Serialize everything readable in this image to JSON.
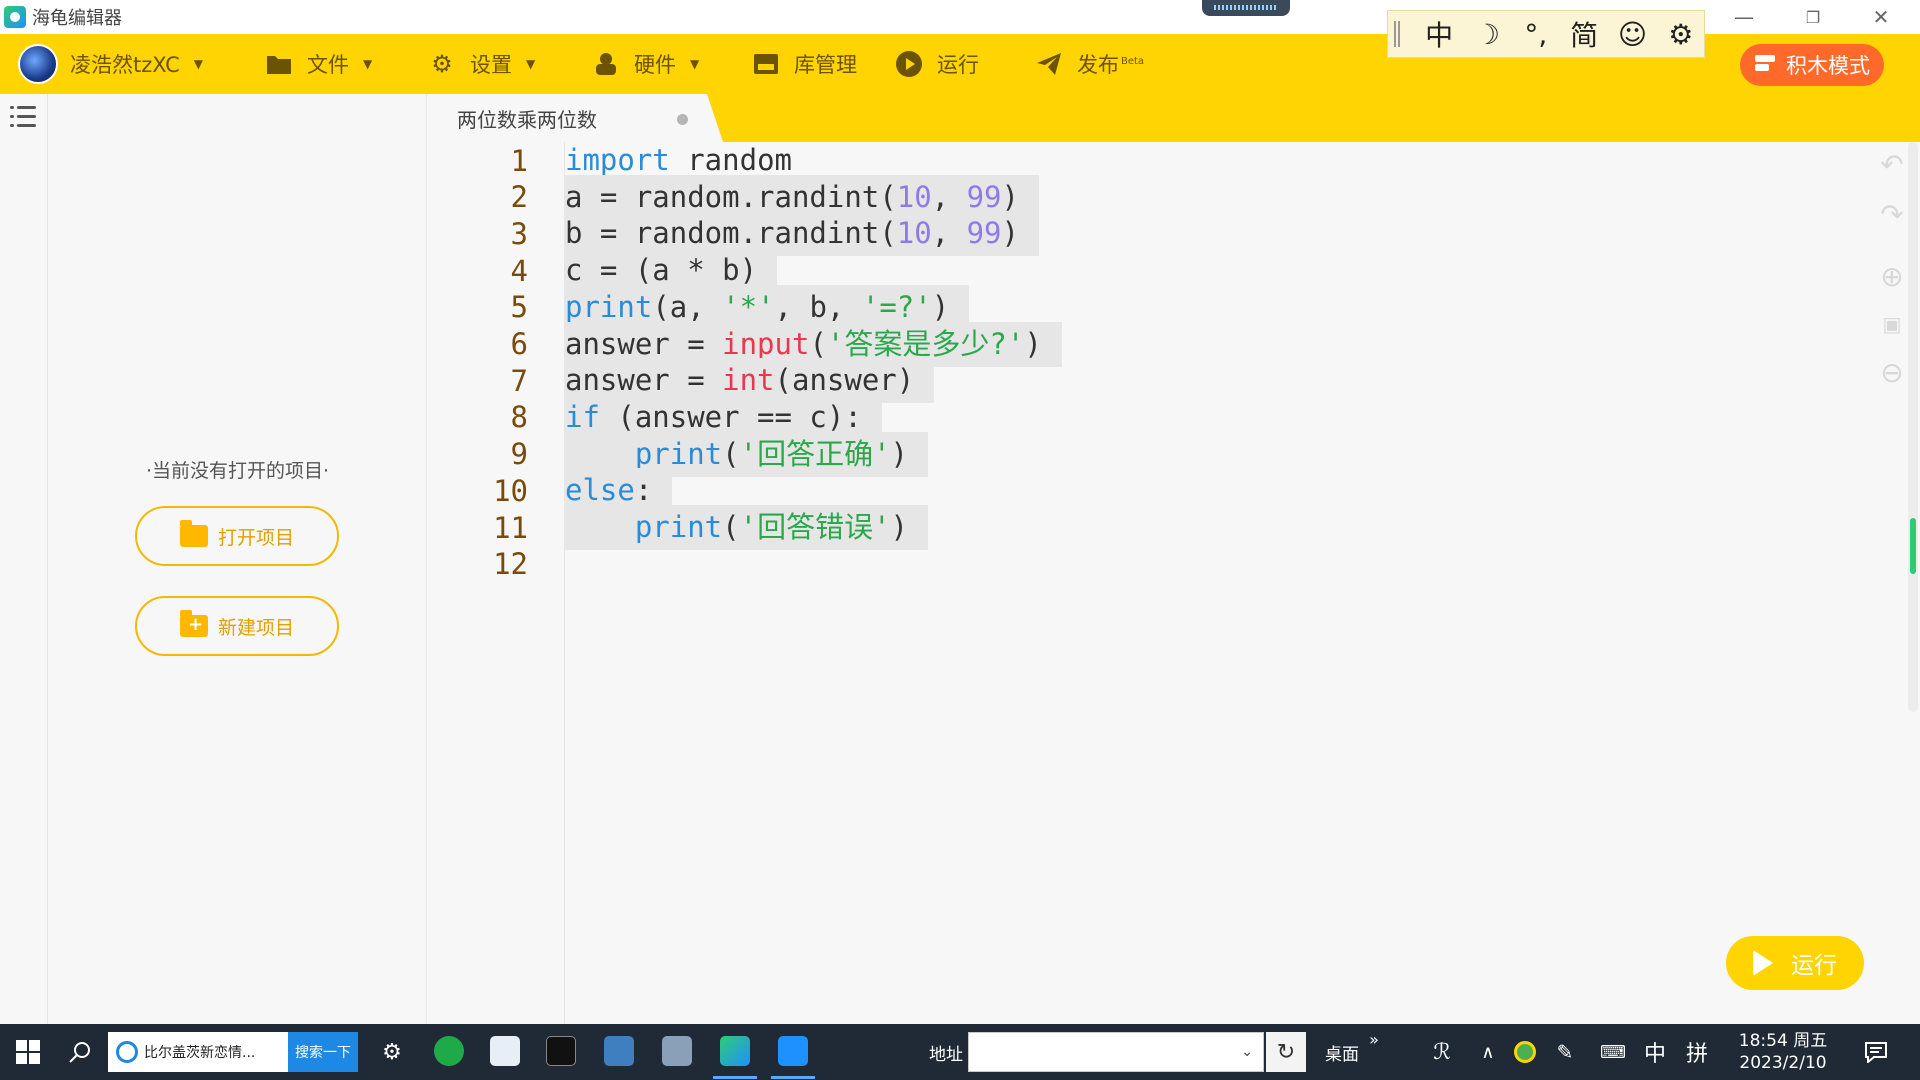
{
  "window": {
    "title": "海龟编辑器",
    "minimize": "—",
    "restore": "❐",
    "close": "✕"
  },
  "ime": {
    "items": [
      {
        "icon": "chinese-mode-icon",
        "glyph": "中"
      },
      {
        "icon": "moon-icon",
        "glyph": "☽"
      },
      {
        "icon": "punctuation-icon",
        "glyph": "°,"
      },
      {
        "icon": "simplified-icon",
        "glyph": "简"
      },
      {
        "icon": "emoji-icon",
        "glyph": "☺"
      },
      {
        "icon": "gear-icon",
        "glyph": "⚙"
      }
    ]
  },
  "toolbar": {
    "user_name": "凌浩然tzXC",
    "file_label": "文件",
    "settings_label": "设置",
    "hardware_label": "硬件",
    "library_label": "库管理",
    "run_label": "运行",
    "publish_label": "发布",
    "publish_badge": "Beta",
    "block_mode_label": "积木模式"
  },
  "tab": {
    "label": "两位数乘两位数"
  },
  "project_panel": {
    "empty_text": "·当前没有打开的项目·",
    "open_label": "打开项目",
    "new_label": "新建项目"
  },
  "editor": {
    "lines": [
      {
        "no": "1",
        "tokens": [
          {
            "t": "import",
            "c": "kw"
          },
          {
            "t": " random",
            "c": ""
          }
        ]
      },
      {
        "no": "2",
        "tokens": [
          {
            "t": "a = random.randint(",
            "c": ""
          },
          {
            "t": "10",
            "c": "num"
          },
          {
            "t": ", ",
            "c": ""
          },
          {
            "t": "99",
            "c": "num"
          },
          {
            "t": ")",
            "c": ""
          }
        ]
      },
      {
        "no": "3",
        "tokens": [
          {
            "t": "b = random.randint(",
            "c": ""
          },
          {
            "t": "10",
            "c": "num"
          },
          {
            "t": ", ",
            "c": ""
          },
          {
            "t": "99",
            "c": "num"
          },
          {
            "t": ")",
            "c": ""
          }
        ]
      },
      {
        "no": "4",
        "tokens": [
          {
            "t": "c = (a * b)",
            "c": ""
          }
        ]
      },
      {
        "no": "5",
        "tokens": [
          {
            "t": "print",
            "c": "fn"
          },
          {
            "t": "(a, ",
            "c": ""
          },
          {
            "t": "'*'",
            "c": "str"
          },
          {
            "t": ", b, ",
            "c": ""
          },
          {
            "t": "'=?'",
            "c": "str"
          },
          {
            "t": ")",
            "c": ""
          }
        ]
      },
      {
        "no": "6",
        "tokens": [
          {
            "t": "answer = ",
            "c": ""
          },
          {
            "t": "input",
            "c": "bi"
          },
          {
            "t": "(",
            "c": ""
          },
          {
            "t": "'答案是多少?'",
            "c": "str"
          },
          {
            "t": ")",
            "c": ""
          }
        ]
      },
      {
        "no": "7",
        "tokens": [
          {
            "t": "answer = ",
            "c": ""
          },
          {
            "t": "int",
            "c": "bi"
          },
          {
            "t": "(answer)",
            "c": ""
          }
        ]
      },
      {
        "no": "8",
        "tokens": [
          {
            "t": "if",
            "c": "kw"
          },
          {
            "t": " (answer == c):",
            "c": ""
          }
        ]
      },
      {
        "no": "9",
        "tokens": [
          {
            "t": "    ",
            "c": ""
          },
          {
            "t": "print",
            "c": "fn"
          },
          {
            "t": "(",
            "c": ""
          },
          {
            "t": "'回答正确'",
            "c": "str"
          },
          {
            "t": ")",
            "c": ""
          }
        ]
      },
      {
        "no": "10",
        "tokens": [
          {
            "t": "else",
            "c": "kw"
          },
          {
            "t": ":",
            "c": ""
          }
        ]
      },
      {
        "no": "11",
        "tokens": [
          {
            "t": "    ",
            "c": ""
          },
          {
            "t": "print",
            "c": "fn"
          },
          {
            "t": "(",
            "c": ""
          },
          {
            "t": "'回答错误'",
            "c": "str"
          },
          {
            "t": ")",
            "c": ""
          }
        ]
      },
      {
        "no": "12",
        "tokens": []
      }
    ]
  },
  "run_fab": {
    "label": "运行"
  },
  "taskbar": {
    "browser_title": "比尔盖茨新恋情...",
    "search_label": "搜索一下",
    "address_label": "地址",
    "address_value": "",
    "desktop_label": "桌面",
    "expand_glyph": "»",
    "ime_label": "中",
    "ime_layout_label": "拼",
    "time": "18:54 周五",
    "date": "2023/2/10"
  },
  "colors": {
    "toolbar_yellow": "#ffd400",
    "block_mode_orange": "#ff6a2b",
    "keyword_blue": "#2a8bd8",
    "builtin_red": "#e8384f",
    "number_purple": "#8f7ae6",
    "string_green": "#2ba84a",
    "taskbar": "#202a36"
  }
}
